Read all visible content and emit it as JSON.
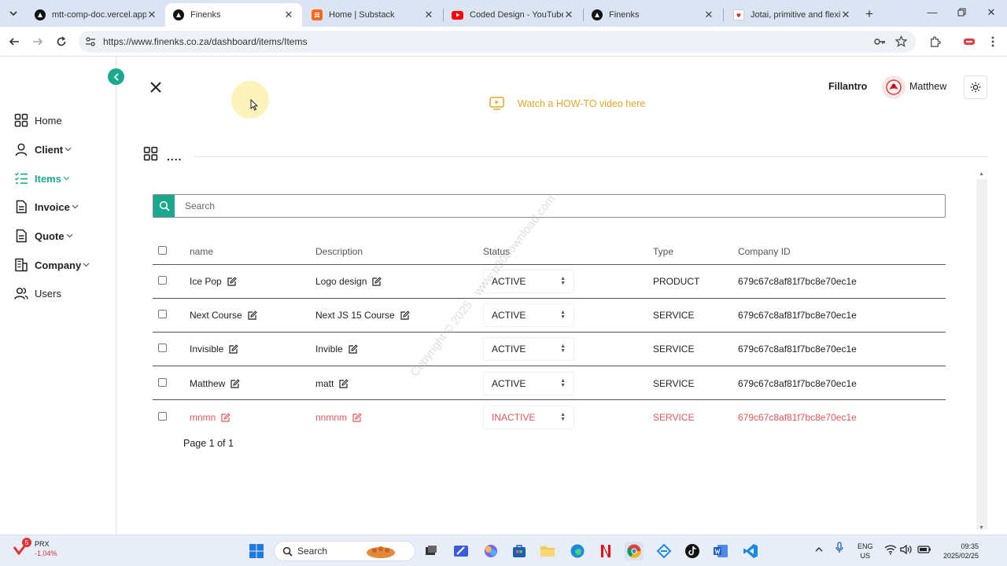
{
  "browser": {
    "tabs": [
      {
        "title": "mtt-comp-doc.vercel.app",
        "favicon": "vercel-icon",
        "active": false
      },
      {
        "title": "Finenks",
        "favicon": "vercel-icon",
        "active": true
      },
      {
        "title": "Home | Substack",
        "favicon": "substack-icon",
        "active": false
      },
      {
        "title": "Coded Design - YouTube",
        "favicon": "youtube-icon",
        "active": false
      },
      {
        "title": "Finenks",
        "favicon": "vercel-icon",
        "active": false
      },
      {
        "title": "Jotai, primitive and flexible",
        "favicon": "jotai-icon",
        "active": false
      }
    ],
    "new_tab": "+",
    "url": "https://www.finenks.co.za/dashboard/items/Items"
  },
  "sidebar": {
    "items": [
      {
        "label": "Home",
        "icon": "home-grid-icon",
        "has_submenu": false,
        "active": false
      },
      {
        "label": "Client",
        "icon": "user-icon",
        "has_submenu": true,
        "active": false
      },
      {
        "label": "Items",
        "icon": "list-icon",
        "has_submenu": true,
        "active": true
      },
      {
        "label": "Invoice",
        "icon": "document-icon",
        "has_submenu": true,
        "active": false
      },
      {
        "label": "Quote",
        "icon": "document-icon",
        "has_submenu": true,
        "active": false
      },
      {
        "label": "Company",
        "icon": "building-icon",
        "has_submenu": true,
        "active": false
      },
      {
        "label": "Users",
        "icon": "users-icon",
        "has_submenu": false,
        "active": false
      }
    ]
  },
  "header": {
    "howto": "Watch a HOW-TO video here",
    "org": "Fillantro",
    "user": "Matthew"
  },
  "toolbar": {
    "dots": "...."
  },
  "search": {
    "placeholder": "Search"
  },
  "table": {
    "columns": [
      "name",
      "Description",
      "Status",
      "Type",
      "Company ID"
    ],
    "rows": [
      {
        "name": "Ice Pop",
        "description": "Logo design",
        "status": "ACTIVE",
        "type": "PRODUCT",
        "company_id": "679c67c8af81f7bc8e70ec1e"
      },
      {
        "name": "Next Course",
        "description": "Next JS 15 Course",
        "status": "ACTIVE",
        "type": "SERVICE",
        "company_id": "679c67c8af81f7bc8e70ec1e"
      },
      {
        "name": "Invisible",
        "description": "Invible",
        "status": "ACTIVE",
        "type": "SERVICE",
        "company_id": "679c67c8af81f7bc8e70ec1e"
      },
      {
        "name": "Matthew",
        "description": "matt",
        "status": "ACTIVE",
        "type": "SERVICE",
        "company_id": "679c67c8af81f7bc8e70ec1e"
      },
      {
        "name": "mnmn",
        "description": "nnmnm",
        "status": "INACTIVE",
        "type": "SERVICE",
        "company_id": "679c67c8af81f7bc8e70ec1e"
      }
    ],
    "page_info": "Page 1 of 1"
  },
  "watermark": "Copyright © 2025 - www.p30download.com",
  "taskbar": {
    "stock_name": "PRX",
    "stock_change": "-1,04%",
    "stock_badge": "5",
    "search_label": "Search",
    "lang_line1": "ENG",
    "lang_line2": "US",
    "time": "09:35",
    "date": "2025/02/25"
  },
  "colors": {
    "accent": "#1aa88e",
    "howto": "#e0a928",
    "inactive": "#e05757"
  }
}
